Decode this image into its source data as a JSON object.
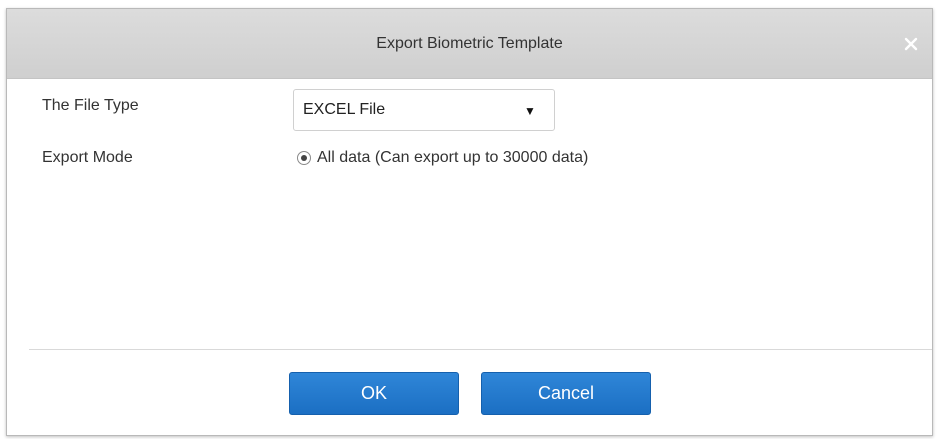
{
  "dialog": {
    "title": "Export Biometric Template",
    "close_icon": "close-icon"
  },
  "form": {
    "file_type_label": "The File Type",
    "file_type_value": "EXCEL File",
    "dropdown_icon": "triangle-down-icon",
    "export_mode_label": "Export Mode",
    "export_mode_option": "All data (Can export up to 30000 data)",
    "export_mode_selected": true
  },
  "buttons": {
    "ok_label": "OK",
    "cancel_label": "Cancel"
  },
  "colors": {
    "titlebar": "#d6d6d6",
    "button_primary": "#2179cc",
    "text": "#333333"
  }
}
